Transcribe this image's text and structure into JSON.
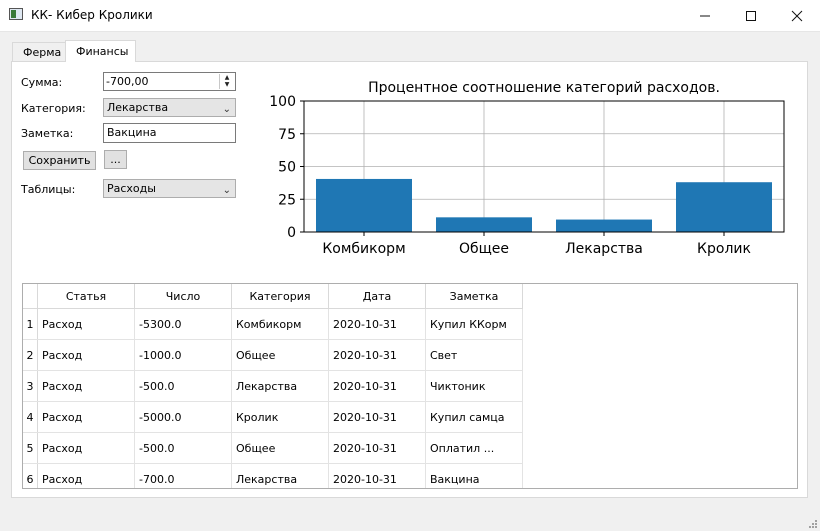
{
  "window": {
    "title": "КК- Кибер Кролики",
    "minimize_glyph": "—",
    "maximize_glyph": "☐",
    "close_glyph": "✕"
  },
  "tabs": [
    {
      "label": "Ферма",
      "active": false
    },
    {
      "label": "Финансы",
      "active": true
    }
  ],
  "form": {
    "amount_label": "Сумма:",
    "amount_value": "-700,00",
    "category_label": "Категория:",
    "category_value": "Лекарства",
    "note_label": "Заметка:",
    "note_value": "Вакцина",
    "save_label": "Сохранить",
    "more_label": "...",
    "tables_label": "Таблицы:",
    "tables_value": "Расходы"
  },
  "chart_data": {
    "type": "bar",
    "title": "Процентное соотношение категорий расходов.",
    "categories": [
      "Комбикорм",
      "Общее",
      "Лекарства",
      "Кролик"
    ],
    "values": [
      40.5,
      11.2,
      9.5,
      38.0
    ],
    "ylim": [
      0,
      100
    ],
    "yticks": [
      0,
      25,
      50,
      75,
      100
    ],
    "grid": true,
    "bar_color": "#1f77b4",
    "xlabel": "",
    "ylabel": ""
  },
  "table": {
    "headers": [
      "Статья",
      "Число",
      "Категория",
      "Дата",
      "Заметка"
    ],
    "rows": [
      {
        "n": "1",
        "cells": [
          "Расход",
          "-5300.0",
          "Комбикорм",
          "2020-10-31",
          "Купил ККорм"
        ]
      },
      {
        "n": "2",
        "cells": [
          "Расход",
          "-1000.0",
          "Общее",
          "2020-10-31",
          "Свет"
        ]
      },
      {
        "n": "3",
        "cells": [
          "Расход",
          "-500.0",
          "Лекарства",
          "2020-10-31",
          "Чиктоник"
        ]
      },
      {
        "n": "4",
        "cells": [
          "Расход",
          "-5000.0",
          "Кролик",
          "2020-10-31",
          "Купил самца"
        ]
      },
      {
        "n": "5",
        "cells": [
          "Расход",
          "-500.0",
          "Общее",
          "2020-10-31",
          "Оплатил ..."
        ]
      },
      {
        "n": "6",
        "cells": [
          "Расход",
          "-700.0",
          "Лекарства",
          "2020-10-31",
          "Вакцина"
        ]
      }
    ]
  }
}
